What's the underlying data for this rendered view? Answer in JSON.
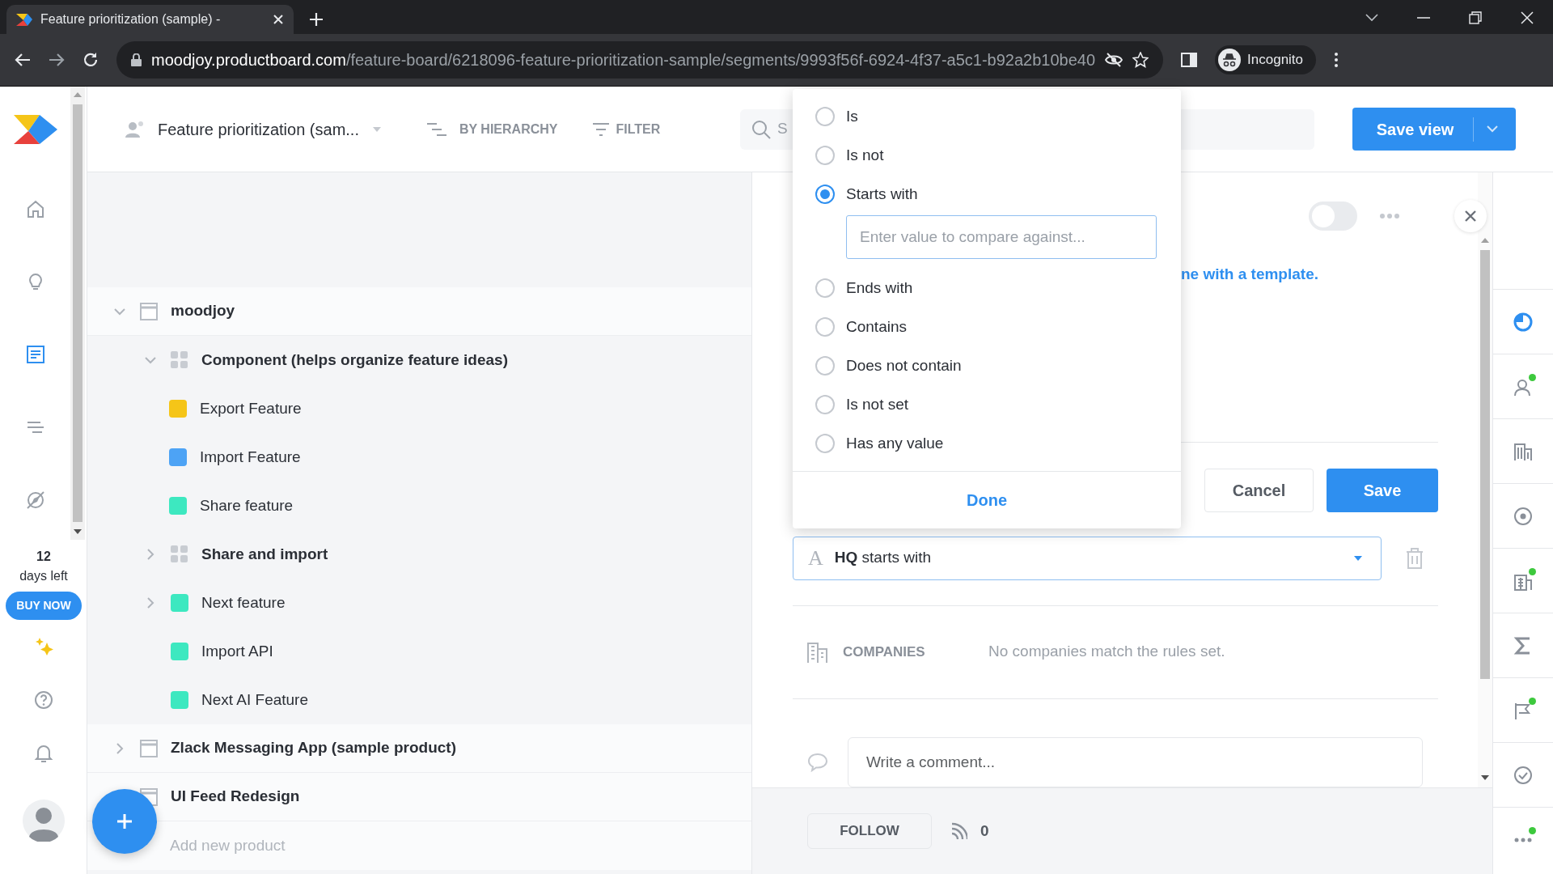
{
  "browser": {
    "tab_title": "Feature prioritization (sample) -",
    "url_host": "moodjoy.productboard.com",
    "url_path": "/feature-board/6218096-feature-prioritization-sample/segments/9993f56f-6924-4f37-a5c1-b92a2b10be40",
    "profile": "Incognito"
  },
  "left_nav": {
    "items": [
      {
        "kind": "home",
        "selected": false
      },
      {
        "kind": "bulb",
        "selected": false
      },
      {
        "kind": "board",
        "selected": true
      },
      {
        "kind": "roadmap",
        "selected": false
      },
      {
        "kind": "insights",
        "selected": false
      }
    ],
    "trial_days": "12",
    "trial_label": "days left",
    "buy_button": "BUY NOW"
  },
  "header": {
    "board_title": "Feature prioritization (sam...",
    "group_by": "BY HIERARCHY",
    "filter": "FILTER",
    "search_text": "S",
    "save_view": "Save view"
  },
  "tree": [
    {
      "label": "moodjoy",
      "kind": "product",
      "expanded": true,
      "children": [
        {
          "label": "Component (helps organize feature ideas)",
          "kind": "component",
          "expanded": true,
          "children": [
            {
              "label": "Export Feature",
              "kind": "feature",
              "color": "#f5c518"
            },
            {
              "label": "Import Feature",
              "kind": "feature",
              "color": "#4da3f5"
            },
            {
              "label": "Share feature",
              "kind": "feature",
              "color": "#3de8c0"
            }
          ]
        },
        {
          "label": "Share and import",
          "kind": "component",
          "expanded": false
        },
        {
          "label": "Next feature",
          "kind": "feature",
          "color": "#3de8c0",
          "expanded": false
        },
        {
          "label": "Import API",
          "kind": "feature",
          "color": "#3de8c0"
        },
        {
          "label": "Next AI Feature",
          "kind": "feature",
          "color": "#3de8c0"
        }
      ]
    },
    {
      "label": "Zlack Messaging App (sample product)",
      "kind": "product",
      "expanded": false
    },
    {
      "label": "UI Feed Redesign",
      "kind": "product"
    }
  ],
  "add_product": "Add new product",
  "operator_menu": {
    "options": [
      {
        "label": "Is",
        "selected": false
      },
      {
        "label": "Is not",
        "selected": false
      },
      {
        "label": "Starts with",
        "selected": true
      },
      {
        "label": "Ends with",
        "selected": false
      },
      {
        "label": "Contains",
        "selected": false
      },
      {
        "label": "Does not contain",
        "selected": false
      },
      {
        "label": "Is not set",
        "selected": false
      },
      {
        "label": "Has any value",
        "selected": false
      }
    ],
    "value_placeholder": "Enter value to compare against...",
    "done": "Done"
  },
  "panel": {
    "toggle_on": false,
    "template_link": "ne with a template.",
    "cancel": "Cancel",
    "save": "Save",
    "rule": {
      "type_icon": "A",
      "text": "**HQ** starts with"
    },
    "companies_label": "COMPANIES",
    "companies_empty": "No companies match the rules set.",
    "comment_placeholder": "Write a comment...",
    "follow": "FOLLOW",
    "followers": "0"
  },
  "right_rail": [
    {
      "kind": "pie",
      "selected": true,
      "dot": false
    },
    {
      "kind": "user",
      "selected": false,
      "dot": true
    },
    {
      "kind": "building",
      "selected": false,
      "dot": false
    },
    {
      "kind": "target",
      "selected": false,
      "dot": false
    },
    {
      "kind": "grid",
      "selected": false,
      "dot": true
    },
    {
      "kind": "sigma",
      "selected": false,
      "dot": false
    },
    {
      "kind": "flag",
      "selected": false,
      "dot": true
    },
    {
      "kind": "check",
      "selected": false,
      "dot": false
    },
    {
      "kind": "more",
      "selected": false,
      "dot": true
    }
  ]
}
